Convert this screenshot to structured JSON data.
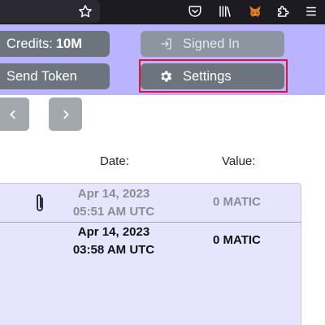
{
  "browser": {
    "toolbar_icons": [
      "star-icon",
      "pocket-icon",
      "library-icon",
      "metamask-icon",
      "extensions-icon",
      "menu-icon"
    ]
  },
  "header": {
    "credits_label": "Credits:",
    "credits_value": "10M",
    "send_token_label": "Send Token",
    "signed_in_label": "Signed In",
    "settings_label": "Settings",
    "background_color": "#bab3ff",
    "button_color": "#6c757d",
    "focus_color": "#e0142c"
  },
  "table": {
    "date_header": "Date:",
    "value_header": "Value:",
    "rows": [
      {
        "date": "Apr 14, 2023",
        "time": "05:51 AM UTC",
        "value": "0 MATIC",
        "has_attachment": true,
        "muted": true
      },
      {
        "date": "Apr 14, 2023",
        "time": "03:58 AM UTC",
        "value": "0 MATIC",
        "has_attachment": false,
        "muted": false
      }
    ]
  }
}
